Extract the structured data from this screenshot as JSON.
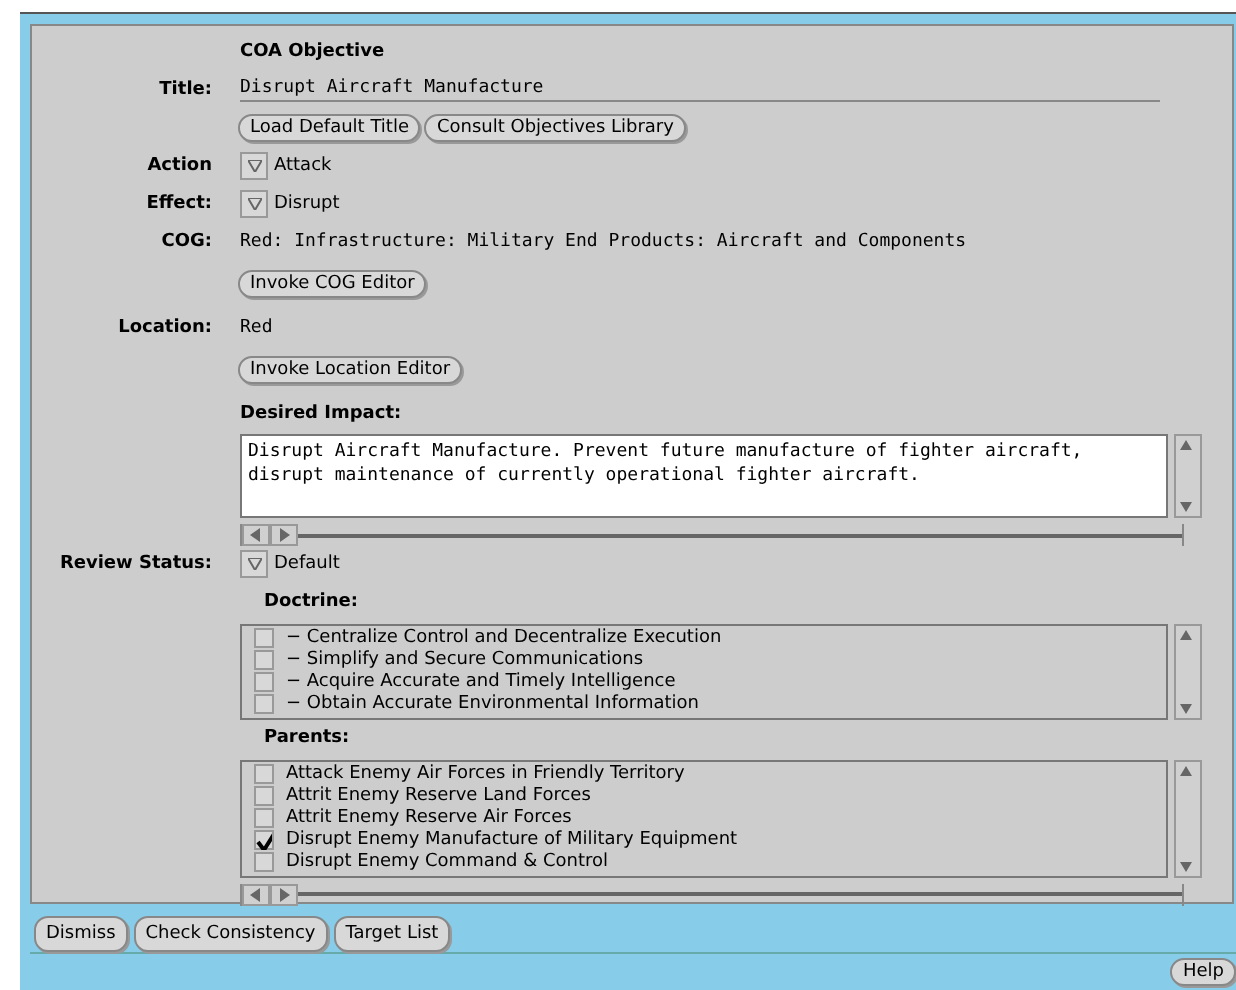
{
  "heading": "COA Objective",
  "title": {
    "label": "Title:",
    "value": "Disrupt Aircraft Manufacture"
  },
  "title_buttons": [
    "Load Default Title",
    "Consult Objectives Library"
  ],
  "action": {
    "label": "Action",
    "value": "Attack"
  },
  "effect": {
    "label": "Effect:",
    "value": "Disrupt"
  },
  "cog": {
    "label": "COG:",
    "value": "Red: Infrastructure: Military End Products: Aircraft and Components",
    "button": "Invoke COG Editor"
  },
  "location": {
    "label": "Location:",
    "value": "Red",
    "button": "Invoke Location Editor"
  },
  "desired_impact": {
    "label": "Desired Impact:",
    "value": "Disrupt Aircraft Manufacture. Prevent future manufacture of fighter aircraft,\ndisrupt maintenance of currently operational fighter aircraft."
  },
  "review_status": {
    "label": "Review Status:",
    "value": "Default"
  },
  "doctrine": {
    "label": "Doctrine:",
    "items": [
      {
        "text": "− Centralize Control and Decentralize Execution",
        "checked": false
      },
      {
        "text": "− Simplify and Secure Communications",
        "checked": false
      },
      {
        "text": "− Acquire Accurate and Timely Intelligence",
        "checked": false
      },
      {
        "text": "− Obtain Accurate Environmental Information",
        "checked": false
      }
    ]
  },
  "parents": {
    "label": "Parents:",
    "items": [
      {
        "text": "Attack Enemy Air Forces in Friendly Territory",
        "checked": false
      },
      {
        "text": "Attrit Enemy Reserve Land Forces",
        "checked": false
      },
      {
        "text": "Attrit Enemy Reserve Air Forces",
        "checked": false
      },
      {
        "text": "Disrupt Enemy Manufacture of Military Equipment",
        "checked": true
      },
      {
        "text": "Disrupt Enemy Command & Control",
        "checked": false
      }
    ]
  },
  "footer_buttons": [
    "Dismiss",
    "Check Consistency",
    "Target List"
  ],
  "help_button": "Help"
}
